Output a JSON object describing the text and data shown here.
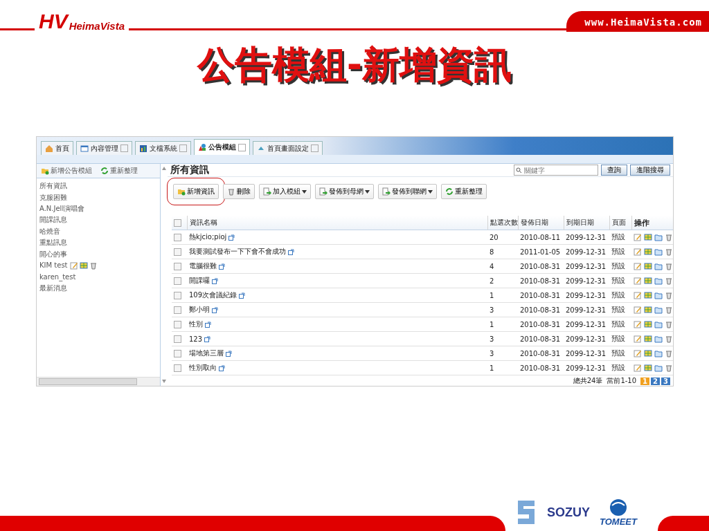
{
  "header": {
    "logo_mark": "HV",
    "logo_text": "HeimaVista",
    "website": "www.HeimaVista.com"
  },
  "title": "公告模組-新增資訊",
  "app": {
    "tabs": [
      {
        "label": "首頁",
        "closable": false,
        "selected": false
      },
      {
        "label": "內容管理",
        "closable": true,
        "selected": false
      },
      {
        "label": "文檔系統",
        "closable": true,
        "selected": false
      },
      {
        "label": "公告模組",
        "closable": true,
        "selected": true
      },
      {
        "label": "首頁畫面設定",
        "closable": true,
        "selected": false
      }
    ],
    "sidebar": {
      "actions": [
        "新增公告模組",
        "重新整理"
      ],
      "items": [
        {
          "label": "所有資訊",
          "show_actions": false
        },
        {
          "label": "克服困難",
          "show_actions": false
        },
        {
          "label": "A.N.Jell演唱會",
          "show_actions": false
        },
        {
          "label": "開課訊息",
          "show_actions": false
        },
        {
          "label": "哈燒音",
          "show_actions": false
        },
        {
          "label": "重點訊息",
          "show_actions": false
        },
        {
          "label": "開心的事",
          "show_actions": false
        },
        {
          "label": "KIM test",
          "show_actions": true
        },
        {
          "label": "karen_test",
          "show_actions": false
        },
        {
          "label": "最新消息",
          "show_actions": false
        }
      ]
    },
    "main": {
      "heading": "所有資訊",
      "search": {
        "placeholder": "關鍵字"
      },
      "search_buttons": [
        "查詢",
        "進階搜尋"
      ],
      "toolbar": [
        {
          "label": "新增資訊",
          "dropdown": false,
          "highlighted": true
        },
        {
          "label": "刪除",
          "dropdown": false,
          "highlighted": false
        },
        {
          "label": "加入模組",
          "dropdown": true,
          "highlighted": false
        },
        {
          "label": "發佈到母網",
          "dropdown": true,
          "highlighted": false
        },
        {
          "label": "發佈到聯網",
          "dropdown": true,
          "highlighted": false
        },
        {
          "label": "重新整理",
          "dropdown": false,
          "highlighted": false
        }
      ],
      "table": {
        "header_checked": false,
        "columns": [
          "資訊名稱",
          "點選次數",
          "發佈日期",
          "到期日期",
          "頁面",
          "操作"
        ],
        "rows": [
          {
            "checked": false,
            "name": "熱kjcio;pioj",
            "clicks": "20",
            "published": "2010-08-11",
            "expires": "2099-12-31",
            "page": "預設"
          },
          {
            "checked": false,
            "name": "我要測試發布一下下會不會成功",
            "clicks": "8",
            "published": "2011-01-05",
            "expires": "2099-12-31",
            "page": "預設"
          },
          {
            "checked": false,
            "name": "電腦很難",
            "clicks": "4",
            "published": "2010-08-31",
            "expires": "2099-12-31",
            "page": "預設"
          },
          {
            "checked": false,
            "name": "開課囉",
            "clicks": "2",
            "published": "2010-08-31",
            "expires": "2099-12-31",
            "page": "預設"
          },
          {
            "checked": false,
            "name": "109次會議紀錄",
            "clicks": "1",
            "published": "2010-08-31",
            "expires": "2099-12-31",
            "page": "預設"
          },
          {
            "checked": false,
            "name": "鄭小明",
            "clicks": "3",
            "published": "2010-08-31",
            "expires": "2099-12-31",
            "page": "預設"
          },
          {
            "checked": false,
            "name": "性別",
            "clicks": "1",
            "published": "2010-08-31",
            "expires": "2099-12-31",
            "page": "預設"
          },
          {
            "checked": false,
            "name": "123",
            "clicks": "3",
            "published": "2010-08-31",
            "expires": "2099-12-31",
            "page": "預設"
          },
          {
            "checked": false,
            "name": "場地第三層",
            "clicks": "3",
            "published": "2010-08-31",
            "expires": "2099-12-31",
            "page": "預設"
          },
          {
            "checked": false,
            "name": "性別取向",
            "clicks": "1",
            "published": "2010-08-31",
            "expires": "2099-12-31",
            "page": "預設"
          }
        ]
      },
      "pagination": {
        "total": "總共24筆",
        "range": "當前1-10",
        "pages": [
          {
            "label": "1",
            "selected": true
          },
          {
            "label": "2",
            "selected": false
          },
          {
            "label": "3",
            "selected": false
          }
        ]
      }
    }
  },
  "footer": {
    "logos": [
      {
        "kind": "graphic"
      },
      {
        "kind": "text",
        "label": "SOZUY"
      },
      {
        "kind": "text",
        "label": "TOMEET"
      }
    ]
  }
}
